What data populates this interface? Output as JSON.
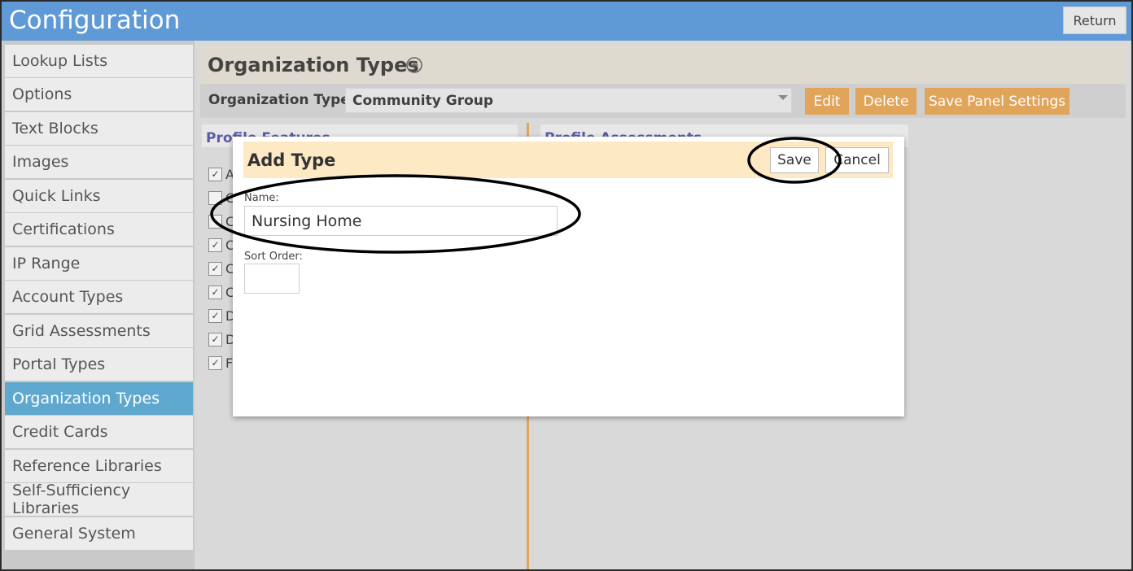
{
  "header": {
    "title": "Configuration",
    "return_label": "Return"
  },
  "sidebar": {
    "items": [
      {
        "label": "Lookup Lists"
      },
      {
        "label": "Options"
      },
      {
        "label": "Text Blocks"
      },
      {
        "label": "Images"
      },
      {
        "label": "Quick Links"
      },
      {
        "label": "Certifications"
      },
      {
        "label": "IP Range"
      },
      {
        "label": "Account Types"
      },
      {
        "label": "Grid Assessments"
      },
      {
        "label": "Portal Types"
      },
      {
        "label": "Organization Types"
      },
      {
        "label": "Credit Cards"
      },
      {
        "label": "Reference Libraries"
      },
      {
        "label": "Self-Sufficiency Libraries"
      },
      {
        "label": "General System"
      }
    ],
    "active_item": "Organization Types"
  },
  "main": {
    "page_title": "Organization Types",
    "type_label": "Organization Type:",
    "type_value": "Community Group",
    "buttons": {
      "edit": "Edit",
      "delete": "Delete",
      "save_panel": "Save Panel Settings"
    },
    "profile_features_label": "Profile Features",
    "profile_assessments_label": "Profile Assessments",
    "background_checks": [
      {
        "checked": true,
        "letter": "A"
      },
      {
        "checked": false,
        "letter": "C"
      },
      {
        "checked": false,
        "letter": "C"
      },
      {
        "checked": true,
        "letter": "C"
      },
      {
        "checked": true,
        "letter": "C"
      },
      {
        "checked": true,
        "letter": "C"
      },
      {
        "checked": true,
        "letter": "D"
      },
      {
        "checked": true,
        "letter": "D"
      },
      {
        "checked": true,
        "letter": "F"
      }
    ]
  },
  "modal": {
    "title": "Add Type",
    "save_label": "Save",
    "cancel_label": "Cancel",
    "name_label": "Name:",
    "name_value": "Nursing Home",
    "sort_label": "Sort Order:",
    "sort_value": ""
  },
  "colors": {
    "header_bg": "#5f9ad6",
    "active_sidebar": "#5ea8d0",
    "accent_orange": "#e0a45a",
    "modal_header_bg": "#fde9c4"
  }
}
